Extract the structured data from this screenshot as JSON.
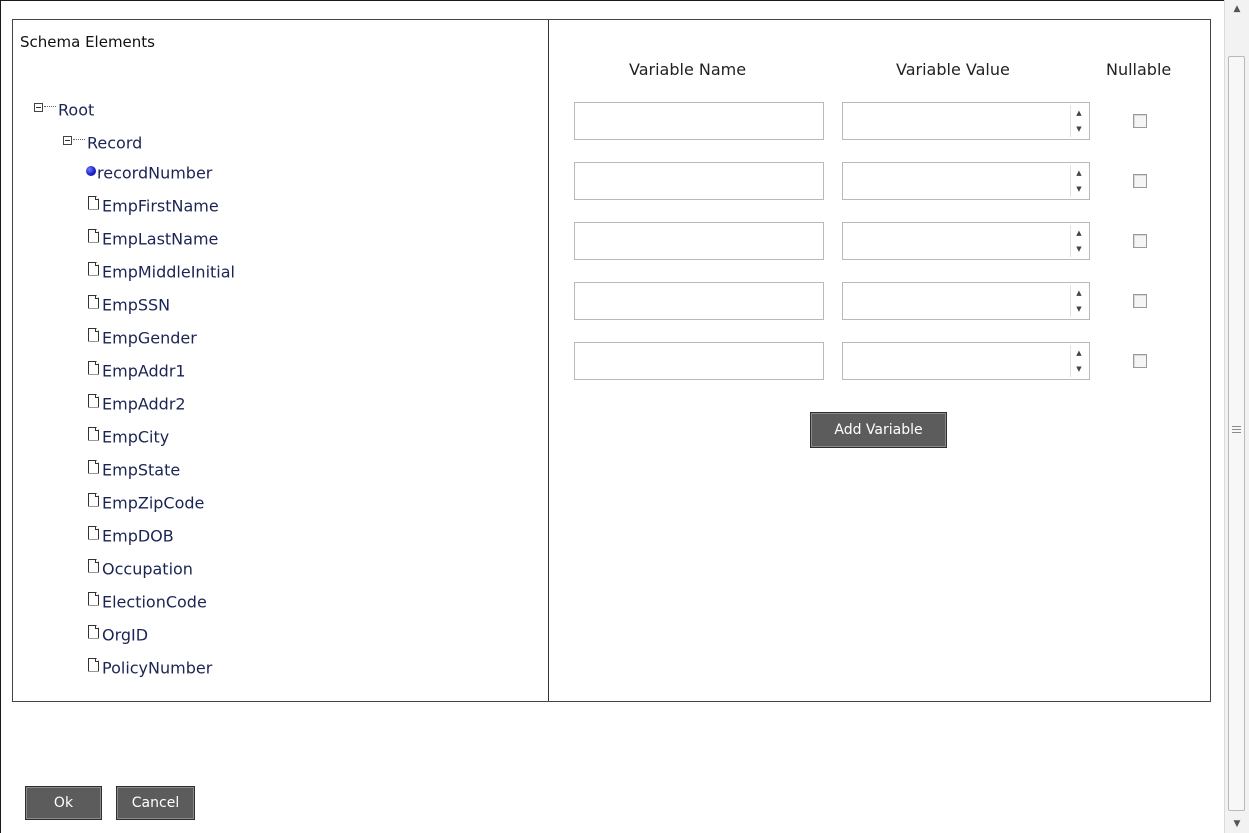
{
  "schema": {
    "title": "Schema Elements",
    "tree": [
      {
        "label": "Root",
        "icon": "expander"
      },
      {
        "label": "Record",
        "icon": "expander"
      },
      {
        "label": "recordNumber",
        "icon": "ball"
      },
      {
        "label": "EmpFirstName",
        "icon": "doc"
      },
      {
        "label": "EmpLastName",
        "icon": "doc"
      },
      {
        "label": "EmpMiddleInitial",
        "icon": "doc"
      },
      {
        "label": "EmpSSN",
        "icon": "doc"
      },
      {
        "label": "EmpGender",
        "icon": "doc"
      },
      {
        "label": "EmpAddr1",
        "icon": "doc"
      },
      {
        "label": "EmpAddr2",
        "icon": "doc"
      },
      {
        "label": "EmpCity",
        "icon": "doc"
      },
      {
        "label": "EmpState",
        "icon": "doc"
      },
      {
        "label": "EmpZipCode",
        "icon": "doc"
      },
      {
        "label": "EmpDOB",
        "icon": "doc"
      },
      {
        "label": "Occupation",
        "icon": "doc"
      },
      {
        "label": "ElectionCode",
        "icon": "doc"
      },
      {
        "label": "OrgID",
        "icon": "doc"
      },
      {
        "label": "PolicyNumber",
        "icon": "doc"
      }
    ]
  },
  "variables": {
    "headers": {
      "name": "Variable Name",
      "value": "Variable Value",
      "nullable": "Nullable"
    },
    "rows": [
      {
        "name": "",
        "value": "",
        "nullable": false
      },
      {
        "name": "",
        "value": "",
        "nullable": false
      },
      {
        "name": "",
        "value": "",
        "nullable": false
      },
      {
        "name": "",
        "value": "",
        "nullable": false
      },
      {
        "name": "",
        "value": "",
        "nullable": false
      }
    ],
    "add_label": "Add Variable"
  },
  "footer": {
    "ok_label": "Ok",
    "cancel_label": "Cancel"
  },
  "colors": {
    "button_bg": "#5c5c5c",
    "tree_text": "#1b2554"
  }
}
